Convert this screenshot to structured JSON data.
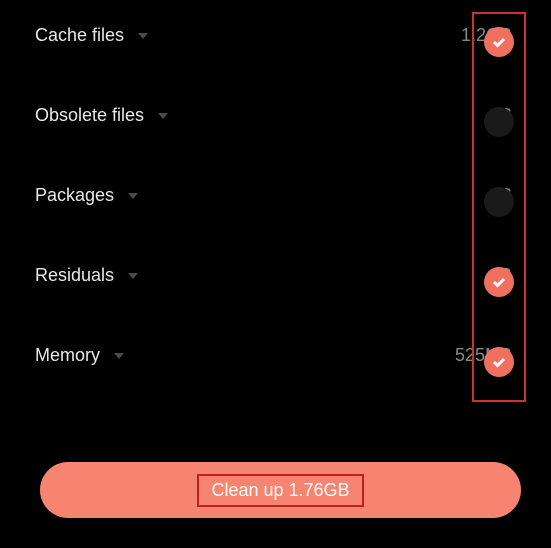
{
  "items": [
    {
      "label": "Cache files",
      "size": "1.2GB",
      "checked": true
    },
    {
      "label": "Obsolete files",
      "size": "0B",
      "checked": false
    },
    {
      "label": "Packages",
      "size": "0B",
      "checked": false
    },
    {
      "label": "Residuals",
      "size": "2B",
      "checked": true
    },
    {
      "label": "Memory",
      "size": "525MB",
      "checked": true
    }
  ],
  "button": {
    "label": "Clean up 1.76GB"
  }
}
